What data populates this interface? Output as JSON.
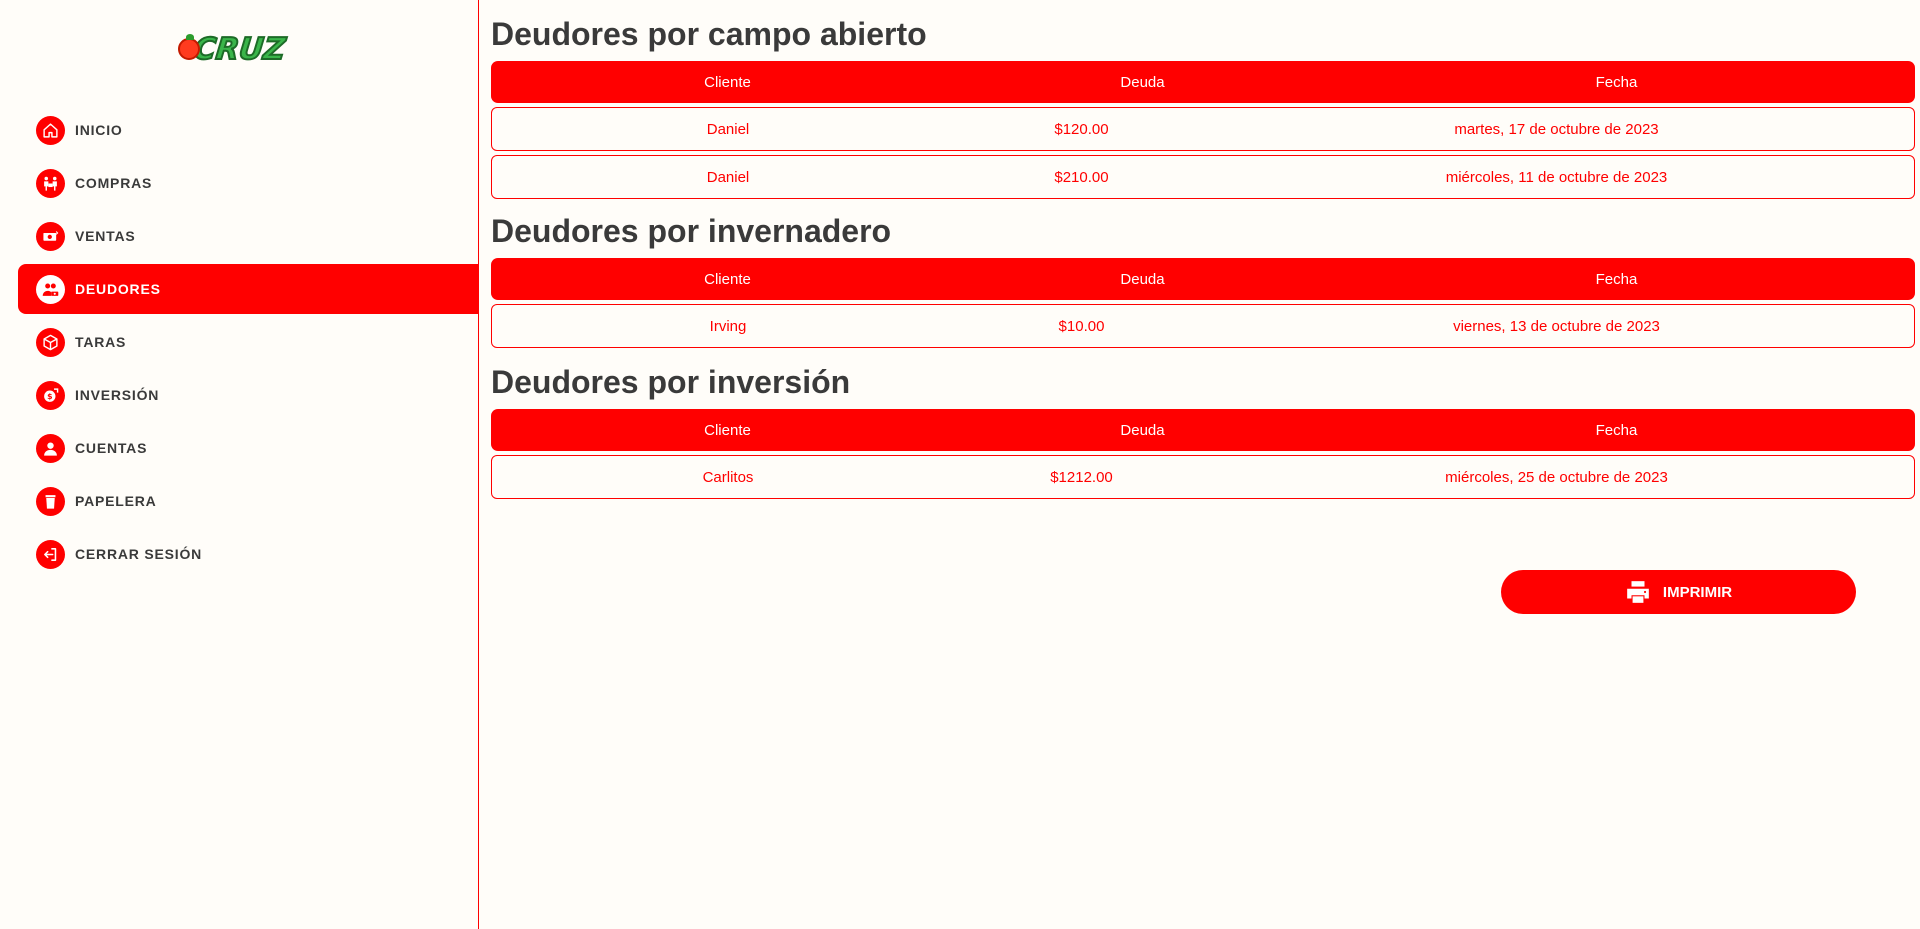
{
  "brand": {
    "logo_text": "CRUZ"
  },
  "sidebar": {
    "items": [
      {
        "label": "INICIO",
        "icon": "home-icon",
        "active": false
      },
      {
        "label": "COMPRAS",
        "icon": "people-purchase-icon",
        "active": false
      },
      {
        "label": "VENTAS",
        "icon": "money-icon",
        "active": false
      },
      {
        "label": "DEUDORES",
        "icon": "debtors-icon",
        "active": true
      },
      {
        "label": "TARAS",
        "icon": "box-icon",
        "active": false
      },
      {
        "label": "INVERSIÓN",
        "icon": "investment-icon",
        "active": false
      },
      {
        "label": "CUENTAS",
        "icon": "user-icon",
        "active": false
      },
      {
        "label": "PAPELERA",
        "icon": "trash-icon",
        "active": false
      },
      {
        "label": "CERRAR SESIÓN",
        "icon": "logout-icon",
        "active": false
      }
    ]
  },
  "columns": {
    "client": "Cliente",
    "debt": "Deuda",
    "date": "Fecha"
  },
  "sections": [
    {
      "title": "Deudores por campo abierto",
      "rows": [
        {
          "client": "Daniel",
          "debt": "$120.00",
          "date": "martes, 17 de octubre de 2023"
        },
        {
          "client": "Daniel",
          "debt": "$210.00",
          "date": "miércoles, 11 de octubre de 2023"
        }
      ]
    },
    {
      "title": "Deudores por invernadero",
      "rows": [
        {
          "client": "Irving",
          "debt": "$10.00",
          "date": "viernes, 13 de octubre de 2023"
        }
      ]
    },
    {
      "title": "Deudores por inversión",
      "rows": [
        {
          "client": "Carlitos",
          "debt": "$1212.00",
          "date": "miércoles, 25 de octubre de 2023"
        }
      ]
    }
  ],
  "print_button": {
    "label": "IMPRIMIR",
    "icon": "printer-icon"
  },
  "colors": {
    "accent": "#ff0000",
    "text": "#3a3a3a",
    "background": "#fffdf9"
  }
}
